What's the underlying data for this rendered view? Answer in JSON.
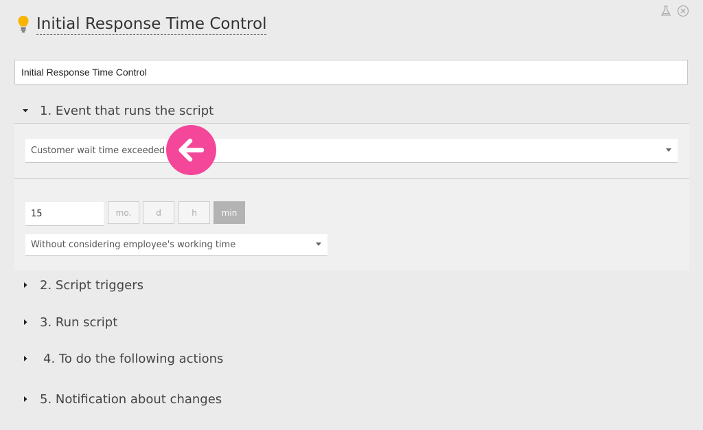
{
  "header": {
    "title": "Initial Response Time Control"
  },
  "name_field": {
    "value": "Initial Response Time Control"
  },
  "sections": [
    {
      "label": "1. Event that runs the script",
      "expanded": true
    },
    {
      "label": "2. Script triggers",
      "expanded": false
    },
    {
      "label": "3. Run script",
      "expanded": false
    },
    {
      "label": "4. To do the following actions",
      "expanded": false
    },
    {
      "label": "5. Notification about changes",
      "expanded": false
    }
  ],
  "event": {
    "selected": "Customer wait time exceeded"
  },
  "wait_time": {
    "value": "15",
    "units": [
      "mo.",
      "d",
      "h",
      "min"
    ],
    "active_unit": "min"
  },
  "working_time": {
    "selected": "Without considering employee's working time"
  },
  "colors": {
    "accent_pink": "#f4479a",
    "bulb_yellow": "#f7b500",
    "active_unit_bg": "#b3b3b3"
  }
}
